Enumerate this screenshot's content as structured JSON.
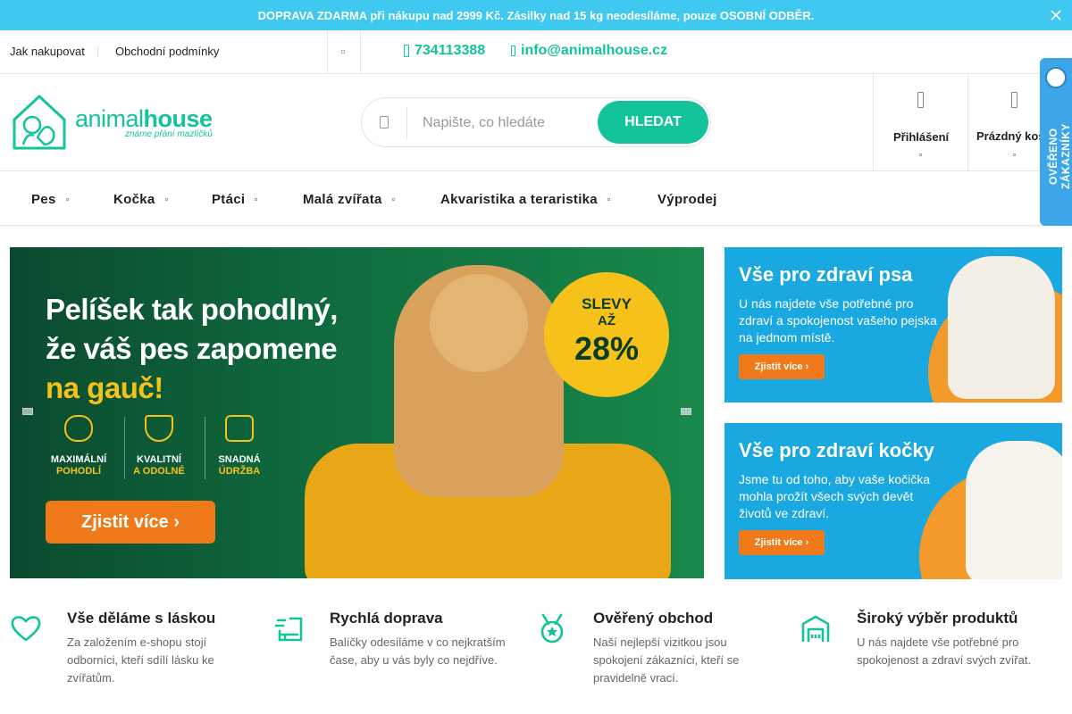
{
  "announcement": {
    "text": "DOPRAVA ZDARMA při nákupu nad 2999 Kč. Zásilky nad 15 kg neodesíláme, pouze OSOBNÍ ODBĚR.",
    "close_icon": "close-icon"
  },
  "utility": {
    "links": [
      "Jak nakupovat",
      "Obchodní podmínky"
    ],
    "phone": "734113388",
    "email": "info@animalhouse.cz"
  },
  "header": {
    "logo_brand_light": "animal",
    "logo_brand_bold": "house",
    "logo_tagline": "známe přání mazlíčků",
    "search_placeholder": "Napište, co hledáte",
    "search_button": "HLEDAT",
    "login_label": "Přihlášení",
    "cart_label": "Prázdný koš"
  },
  "nav": {
    "items": [
      "Pes",
      "Kočka",
      "Ptáci",
      "Malá zvířata",
      "Akvaristika a teraristika",
      "Výprodej"
    ]
  },
  "verified_badge": {
    "text": "OVĚŘENO ZÁKAZNÍKY"
  },
  "hero": {
    "headline_line1": "Pelíšek tak pohodlný,",
    "headline_line2": "že váš pes zapomene",
    "headline_line3": "na gauč!",
    "features": [
      {
        "line1": "MAXIMÁLNÍ",
        "line2": "POHODLÍ"
      },
      {
        "line1": "KVALITNÍ",
        "line2": "A ODOLNÉ"
      },
      {
        "line1": "SNADNÁ",
        "line2": "ÚDRŽBA"
      }
    ],
    "cta": "Zjistit více ›",
    "sale_line1": "SLEVY",
    "sale_line2": "AŽ",
    "sale_value": "28%",
    "colors": {
      "accent": "#f6c21a",
      "cta": "#f07a1a"
    }
  },
  "banners": [
    {
      "title": "Vše pro zdraví psa",
      "description": "U nás najdete vše potřebné pro zdraví a spokojenost vašeho pejska na jednom místě.",
      "button": "Zjistit více ›"
    },
    {
      "title": "Vše pro zdraví kočky",
      "description": "Jsme tu od toho, aby vaše kočička mohla prožít všech svých devět životů ve zdraví.",
      "button": "Zjistit více ›"
    }
  ],
  "usps": [
    {
      "icon": "heart-icon",
      "title": "Vše děláme s láskou",
      "text": "Za založením e-shopu stojí odborníci, kteří sdílí lásku ke zvířatům."
    },
    {
      "icon": "delivery-icon",
      "title": "Rychlá doprava",
      "text": "Balíčky odesíláme v co nejkratším čase, aby u vás byly co nejdříve."
    },
    {
      "icon": "medal-icon",
      "title": "Ověřený obchod",
      "text": "Naší nejlepší vizitkou jsou spokojení zákazníci, kteří se pravidelně vrací."
    },
    {
      "icon": "store-icon",
      "title": "Široký výběr produktů",
      "text": "U nás najdete vše potřebné pro spokojenost a zdraví svých zvířat."
    }
  ],
  "brand_color": "#13c39a"
}
